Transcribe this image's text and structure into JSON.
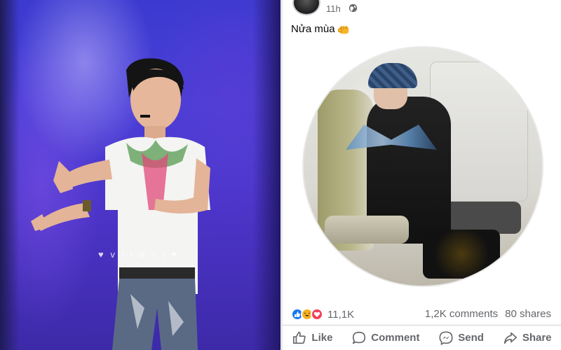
{
  "post": {
    "time": "11h",
    "caption": "Nửa mùa",
    "caption_emoji": "fist-icon",
    "reactions": {
      "icons": [
        "like-icon",
        "haha-icon",
        "love-icon"
      ],
      "count": "11,1K"
    },
    "comments": "1,2K comments",
    "shares": "80 shares",
    "actions": [
      {
        "label": "Like",
        "icon": "like-icon"
      },
      {
        "label": "Comment",
        "icon": "comment-icon"
      },
      {
        "label": "Send",
        "icon": "messenger-icon"
      },
      {
        "label": "Share",
        "icon": "share-icon"
      }
    ]
  },
  "colors": {
    "facebook_blue": "#1877f2",
    "muted_text": "#65676b",
    "love_red": "#f33e58",
    "haha_yellow": "#f7b125"
  }
}
